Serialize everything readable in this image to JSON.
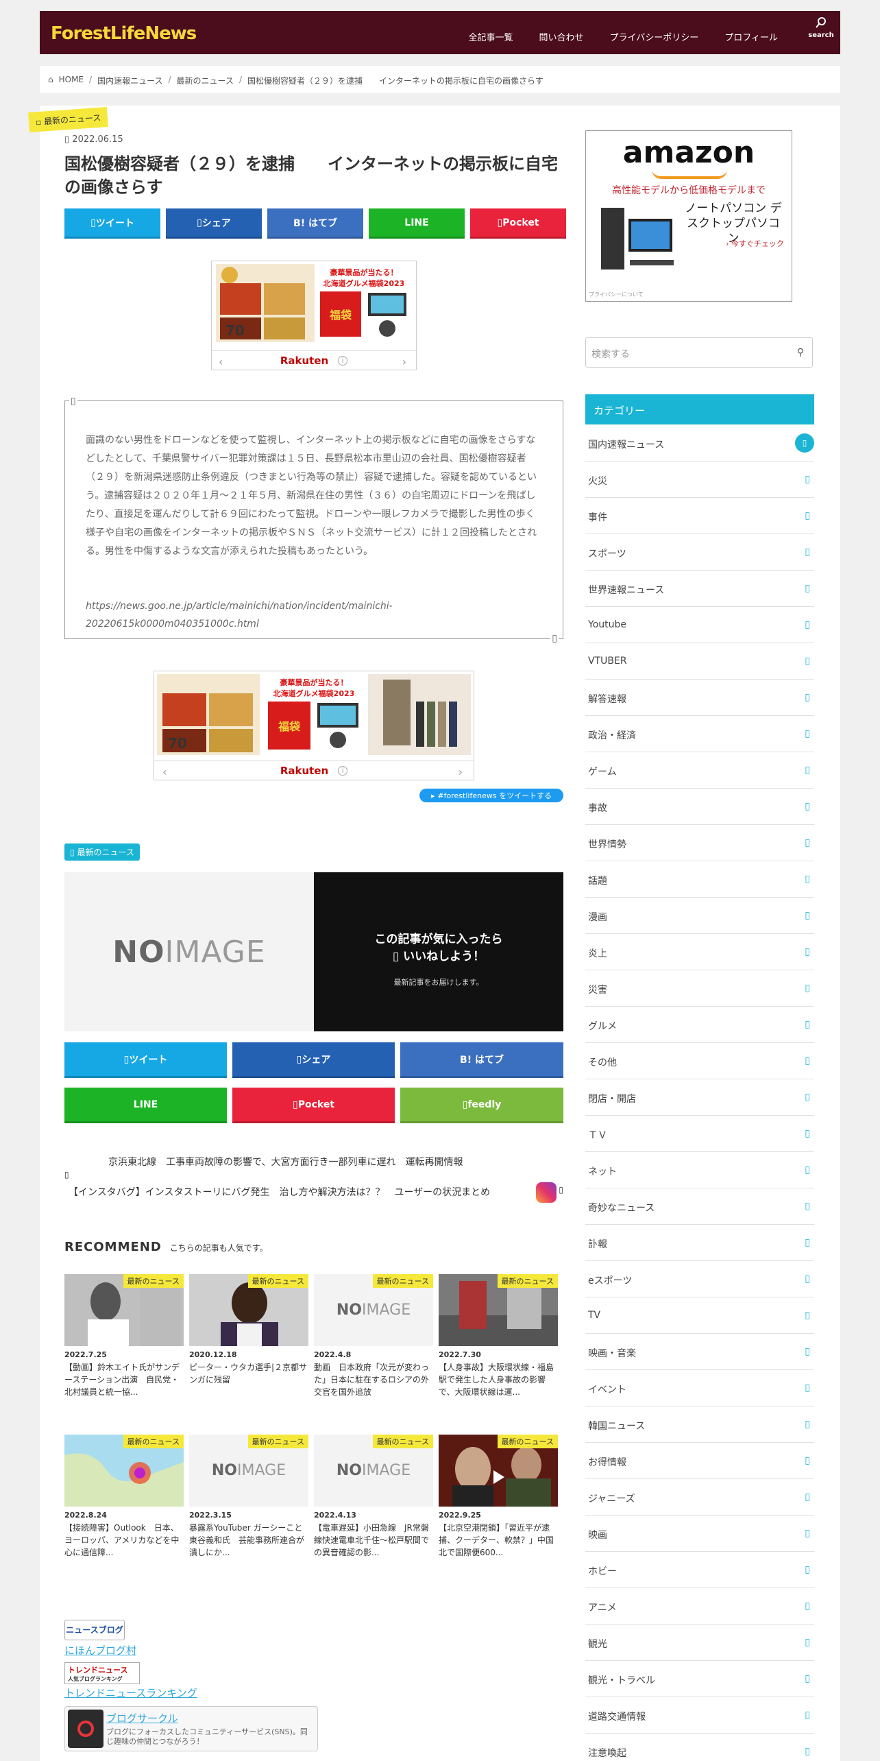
{
  "header": {
    "logo": "ForestLifeNews",
    "nav": [
      "全記事一覧",
      "問い合わせ",
      "プライバシーポリシー",
      "プロフィール"
    ],
    "search_label": "search"
  },
  "breadcrumb": [
    "HOME",
    "国内速報ニュース",
    "最新のニュース",
    "国松優樹容疑者（２９）を逮捕　　インターネットの掲示板に自宅の画像さらす"
  ],
  "article": {
    "category_tag": "最新のニュース",
    "date": "2022.06.15",
    "title": "国松優樹容疑者（２９）を逮捕　　インターネットの掲示板に自宅の画像さらす",
    "quote_text": "面識のない男性をドローンなどを使って監視し、インターネット上の掲示板などに自宅の画像をさらすなどしたとして、千葉県警サイバー犯罪対策課は１５日、長野県松本市里山辺の会社員、国松優樹容疑者（２９）を新潟県迷惑防止条例違反（つきまとい行為等の禁止）容疑で逮捕した。容疑を認めているという。逮捕容疑は２０２０年１月〜２１年５月、新潟県在住の男性（３６）の自宅周辺にドローンを飛ばしたり、直接足を運んだりして計６９回にわたって監視。ドローンや一眼レフカメラで撮影した男性の歩く様子や自宅の画像をインターネットの掲示板やＳＮＳ（ネット交流サービス）に計１２回投稿したとされる。男性を中傷するような文言が添えられた投稿もあったという。",
    "quote_source": "https://news.goo.ne.jp/article/mainichi/nation/incident/mainichi-20220615k0000m040351000c.html",
    "tweet_tag": "#forestlifenews をツイートする",
    "section_badge": "最新のニュース"
  },
  "share_top": [
    "ツイート",
    "シェア",
    "B! はてブ",
    "LINE",
    "Pocket"
  ],
  "share_bottom": [
    "ツイート",
    "シェア",
    "B! はてブ",
    "LINE",
    "Pocket",
    "feedly"
  ],
  "ads": {
    "rakuten": "Rakuten",
    "ad1_text1": "豪華景品が当たる！",
    "ad1_text2": "北海道グルメ福袋2023",
    "ad1_badge": "福袋",
    "ad_item_label": "70"
  },
  "feature": {
    "noimage": [
      "NO",
      "IMAGE"
    ],
    "like_line1": "この記事が気に入ったら",
    "like_line2": "いいねしよう！",
    "like_sub": "最新記事をお届けします。"
  },
  "prev_article": "京浜東北線　工事車両故障の影響で、大宮方面行き一部列車に遅れ　運転再開情報",
  "next_article": "【インスタバグ】インスタストーリにバグ発生　治し方や解決方法は？？　ユーザーの状況まとめ",
  "recommend": {
    "title": "RECOMMEND",
    "subtitle": "こちらの記事も人気です。",
    "tag": "最新のニュース",
    "cards": [
      {
        "date": "2022.7.25",
        "title": "【動画】鈴木エイト氏がサンデーステーション出演　自民党・北村議員と統一協..."
      },
      {
        "date": "2020.12.18",
        "title": "ピーター・ウタカ選手|２京都サンガに残留"
      },
      {
        "date": "2022.4.8",
        "title": "動画　日本政府「次元が変わった」日本に駐在するロシアの外交官を国外追放"
      },
      {
        "date": "2022.7.30",
        "title": "【人身事故】大阪環状線・福島駅で発生した人身事故の影響で、大阪環状線は運..."
      },
      {
        "date": "2022.8.24",
        "title": "【接続障害】Outlook　日本、ヨーロッパ、アメリカなどを中心に通信障..."
      },
      {
        "date": "2022.3.15",
        "title": "暴露系YouTuber ガーシーこと東谷義和氏　芸能事務所連合が潰しにか..."
      },
      {
        "date": "2022.4.13",
        "title": "【電車遅延】小田急線　JR常磐線快速電車北千住～松戸駅間での異音確認の影..."
      },
      {
        "date": "2022.9.25",
        "title": "【北京空港閉鎖】「習近平が逮捕、クーデター、軟禁？」中国北で国際便600..."
      }
    ]
  },
  "blog_links": {
    "news_blog": "ニュースブログ",
    "nihon_blog_mura": "にほんブログ村",
    "trend_badge_1": "トレンドニュース",
    "trend_badge_2": "人気ブログランキング",
    "trend_ranking": "トレンドニュースランキング",
    "blog_circle": "ブログサークル",
    "blog_circle_desc": "ブログにフォーカスしたコミュニティーサービス(SNS)。同じ趣味の仲間とつながろう！"
  },
  "sidebar": {
    "amazon": {
      "logo": "amazon",
      "tagline": "高性能モデルから低価格モデルまで",
      "product": "ノートパソコン デスクトップパソコン",
      "cta": "今すぐチェック",
      "privacy": "プライバシーについて"
    },
    "search_placeholder": "検索する",
    "categories_title": "カテゴリー",
    "categories": [
      "国内速報ニュース",
      "火災",
      "事件",
      "スポーツ",
      "世界速報ニュース",
      "Youtube",
      "VTUBER",
      "解答速報",
      "政治・経済",
      "ゲーム",
      "事故",
      "世界情勢",
      "話題",
      "漫画",
      "炎上",
      "災害",
      "グルメ",
      "その他",
      "閉店・開店",
      "ＴＶ",
      "ネット",
      "奇妙なニュース",
      "訃報",
      "eスポーツ",
      "TV",
      "映画・音楽",
      "イベント",
      "韓国ニュース",
      "お得情報",
      "ジャニーズ",
      "映画",
      "ホビー",
      "アニメ",
      "観光",
      "観光・トラベル",
      "道路交通情報",
      "注意喚起"
    ]
  },
  "colors": {
    "header_bg": "#4b0c1c",
    "logo": "#f5d83a",
    "accent": "#1ab4d4",
    "twitter": "#15a8e4",
    "facebook": "#2461b3",
    "hatena": "#3b6fc0",
    "line": "#1cb426",
    "pocket": "#e8233b",
    "feedly": "#7cba3d"
  }
}
